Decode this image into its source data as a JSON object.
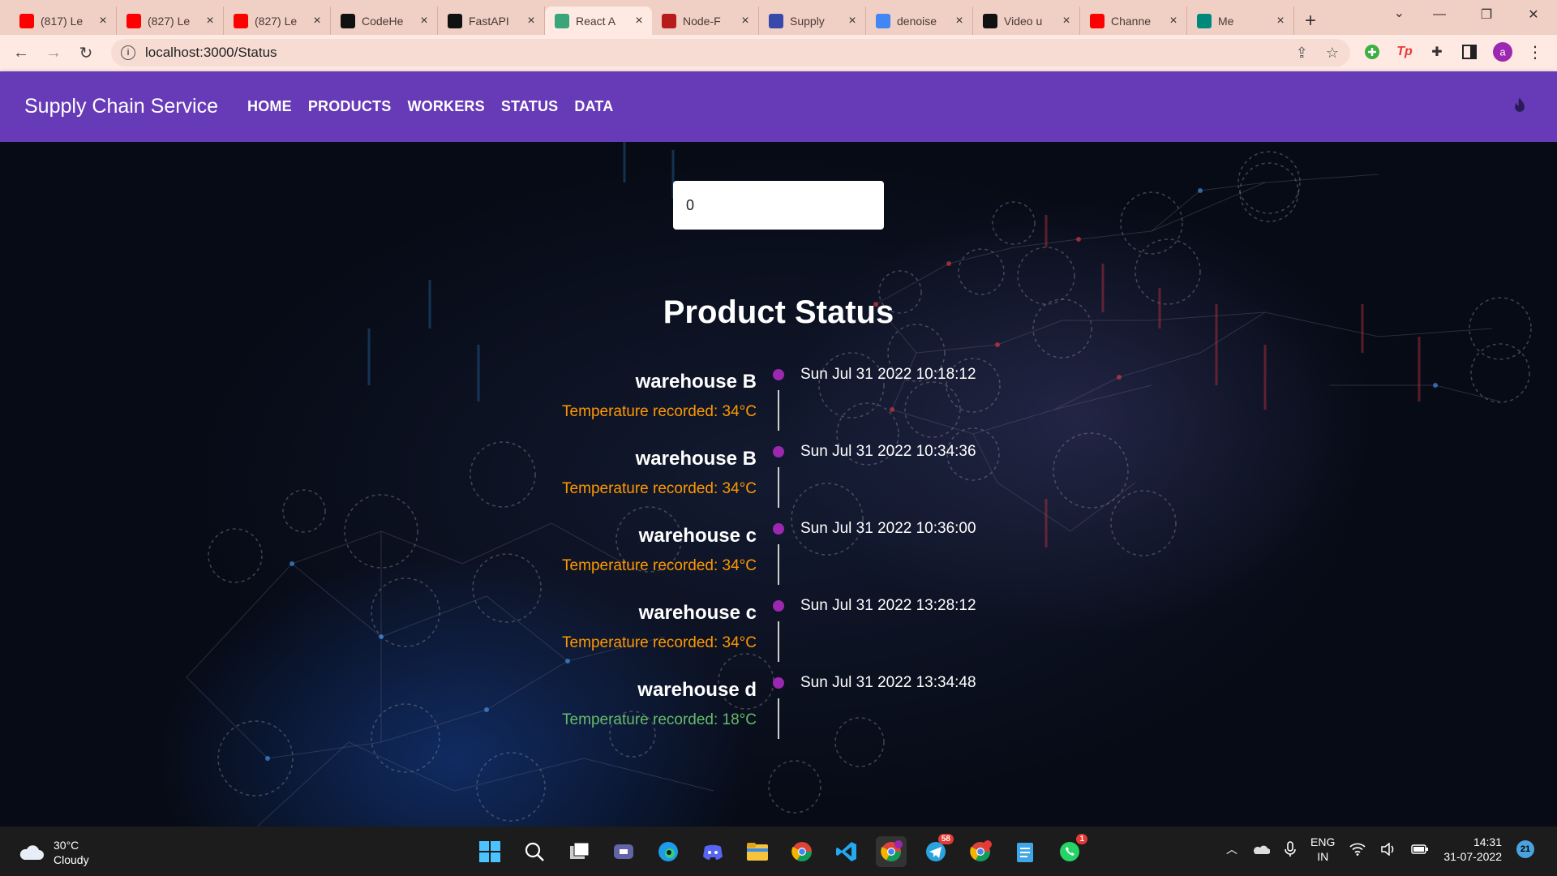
{
  "browser": {
    "tabs": [
      {
        "label": "(817) Le",
        "icon": "youtube-icon",
        "color": "#ff0000"
      },
      {
        "label": "(827) Le",
        "icon": "youtube-icon",
        "color": "#ff0000"
      },
      {
        "label": "(827) Le",
        "icon": "youtube-icon",
        "color": "#ff0000"
      },
      {
        "label": "CodeHe",
        "icon": "github-icon",
        "color": "#111111"
      },
      {
        "label": "FastAPI",
        "icon": "fastapi-icon",
        "color": "#111111"
      },
      {
        "label": "React A",
        "icon": "react-icon",
        "color": "#3aa57a"
      },
      {
        "label": "Node-F",
        "icon": "node-icon",
        "color": "#b71c1c"
      },
      {
        "label": "Supply",
        "icon": "supply-icon",
        "color": "#3949ab"
      },
      {
        "label": "denoise",
        "icon": "google-icon",
        "color": "#4285f4"
      },
      {
        "label": "Video u",
        "icon": "github-icon",
        "color": "#111111"
      },
      {
        "label": "Channe",
        "icon": "youtube-icon",
        "color": "#ff0000"
      },
      {
        "label": "Me",
        "icon": "meet-icon",
        "color": "#00897b"
      }
    ],
    "active_tab": 5,
    "url": "localhost:3000/Status"
  },
  "app": {
    "brand": "Supply Chain Service",
    "nav": [
      "HOME",
      "PRODUCTS",
      "WORKERS",
      "STATUS",
      "DATA"
    ],
    "accent": "#673ab7"
  },
  "search": {
    "value": "0"
  },
  "page_title": "Product Status",
  "timeline": [
    {
      "location": "warehouse B",
      "temperature": "Temperature recorded: 34°C",
      "time": "Sun Jul 31 2022 10:18:12",
      "status_color": "#ff9800"
    },
    {
      "location": "warehouse B",
      "temperature": "Temperature recorded: 34°C",
      "time": "Sun Jul 31 2022 10:34:36",
      "status_color": "#ff9800"
    },
    {
      "location": "warehouse c",
      "temperature": "Temperature recorded: 34°C",
      "time": "Sun Jul 31 2022 10:36:00",
      "status_color": "#ff9800"
    },
    {
      "location": "warehouse c",
      "temperature": "Temperature recorded: 34°C",
      "time": "Sun Jul 31 2022 13:28:12",
      "status_color": "#ff9800"
    },
    {
      "location": "warehouse d",
      "temperature": "Temperature recorded: 18°C",
      "time": "Sun Jul 31 2022 13:34:48",
      "status_color": "#66bb6a"
    }
  ],
  "taskbar": {
    "weather_temp": "30°C",
    "weather_desc": "Cloudy",
    "telegram_badge": "58",
    "whatsapp_badge": "1",
    "lang_top": "ENG",
    "lang_bottom": "IN",
    "time": "14:31",
    "date": "31-07-2022",
    "notifications": "21"
  }
}
